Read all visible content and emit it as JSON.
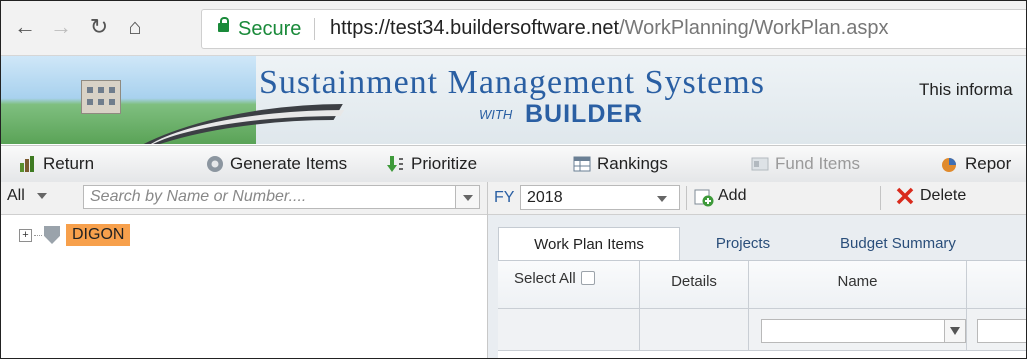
{
  "browser": {
    "secure_label": "Secure",
    "url_host": "https://test34.buildersoftware.net",
    "url_path": "/WorkPlanning/WorkPlan.aspx"
  },
  "banner": {
    "title": "Sustainment Management Systems",
    "with": "WITH",
    "builder": "BUILDER",
    "info_text": "This informa"
  },
  "toolbar": {
    "return": "Return",
    "generate": "Generate Items",
    "prioritize": "Prioritize",
    "rankings": "Rankings",
    "fund_items": "Fund Items",
    "report": "Repor"
  },
  "left": {
    "filter_value": "All",
    "search_placeholder": "Search by Name or Number....",
    "tree_node": "DIGON"
  },
  "right": {
    "fy_label": "FY",
    "fy_value": "2018",
    "add": "Add",
    "delete": "Delete",
    "tabs": [
      "Work Plan Items",
      "Projects",
      "Budget Summary"
    ],
    "columns": [
      "Select All",
      "Details",
      "Name"
    ]
  },
  "colors": {
    "accent": "#2a5fa3",
    "secure": "#1a8a3a",
    "highlight": "#f7a04c"
  }
}
